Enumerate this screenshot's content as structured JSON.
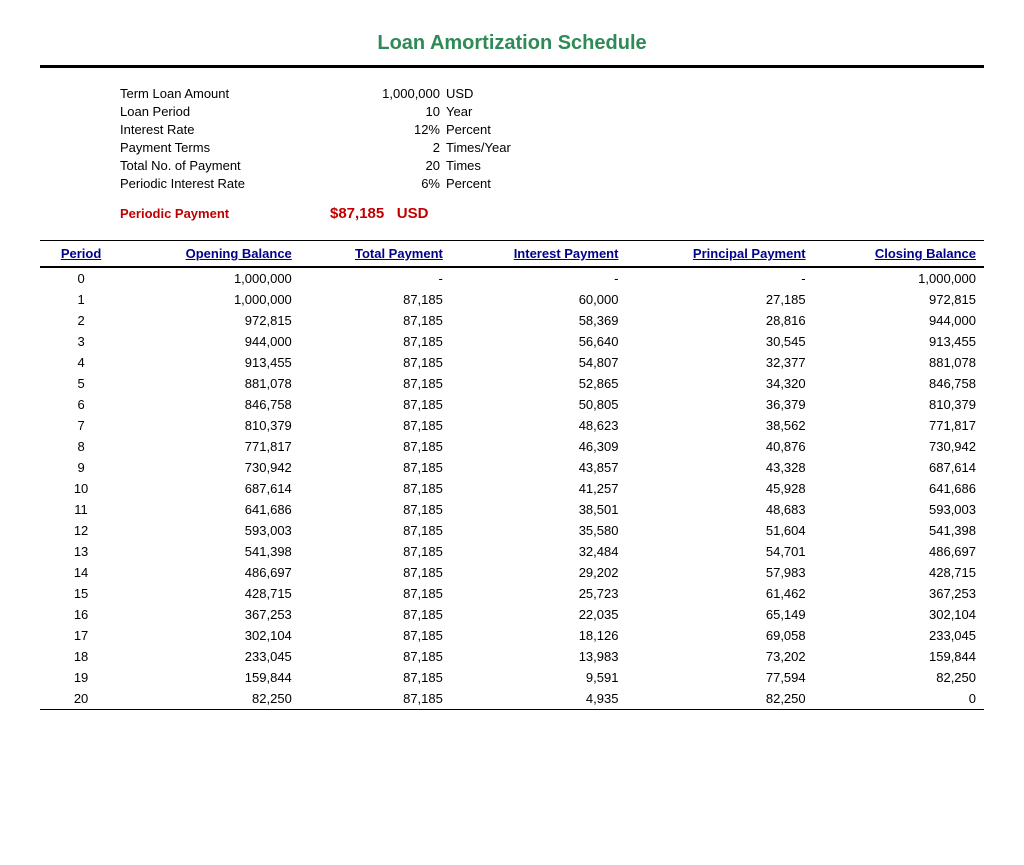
{
  "title": "Loan Amortization Schedule",
  "info": {
    "rows": [
      {
        "label": "Term Loan Amount",
        "value": "1,000,000",
        "unit": "USD"
      },
      {
        "label": "Loan Period",
        "value": "10",
        "unit": "Year"
      },
      {
        "label": "Interest Rate",
        "value": "12%",
        "unit": "Percent"
      },
      {
        "label": "Payment Terms",
        "value": "2",
        "unit": "Times/Year"
      },
      {
        "label": "Total No. of Payment",
        "value": "20",
        "unit": "Times"
      },
      {
        "label": "Periodic Interest Rate",
        "value": "6%",
        "unit": "Percent"
      }
    ]
  },
  "periodic": {
    "label": "Periodic Payment",
    "value": "$87,185",
    "unit": "USD"
  },
  "table": {
    "headers": [
      "Period",
      "Opening Balance",
      "Total Payment",
      "Interest Payment",
      "Principal Payment",
      "Closing Balance"
    ],
    "rows": [
      [
        0,
        "1,000,000",
        "-",
        "-",
        "-",
        "1,000,000"
      ],
      [
        1,
        "1,000,000",
        "87,185",
        "60,000",
        "27,185",
        "972,815"
      ],
      [
        2,
        "972,815",
        "87,185",
        "58,369",
        "28,816",
        "944,000"
      ],
      [
        3,
        "944,000",
        "87,185",
        "56,640",
        "30,545",
        "913,455"
      ],
      [
        4,
        "913,455",
        "87,185",
        "54,807",
        "32,377",
        "881,078"
      ],
      [
        5,
        "881,078",
        "87,185",
        "52,865",
        "34,320",
        "846,758"
      ],
      [
        6,
        "846,758",
        "87,185",
        "50,805",
        "36,379",
        "810,379"
      ],
      [
        7,
        "810,379",
        "87,185",
        "48,623",
        "38,562",
        "771,817"
      ],
      [
        8,
        "771,817",
        "87,185",
        "46,309",
        "40,876",
        "730,942"
      ],
      [
        9,
        "730,942",
        "87,185",
        "43,857",
        "43,328",
        "687,614"
      ],
      [
        10,
        "687,614",
        "87,185",
        "41,257",
        "45,928",
        "641,686"
      ],
      [
        11,
        "641,686",
        "87,185",
        "38,501",
        "48,683",
        "593,003"
      ],
      [
        12,
        "593,003",
        "87,185",
        "35,580",
        "51,604",
        "541,398"
      ],
      [
        13,
        "541,398",
        "87,185",
        "32,484",
        "54,701",
        "486,697"
      ],
      [
        14,
        "486,697",
        "87,185",
        "29,202",
        "57,983",
        "428,715"
      ],
      [
        15,
        "428,715",
        "87,185",
        "25,723",
        "61,462",
        "367,253"
      ],
      [
        16,
        "367,253",
        "87,185",
        "22,035",
        "65,149",
        "302,104"
      ],
      [
        17,
        "302,104",
        "87,185",
        "18,126",
        "69,058",
        "233,045"
      ],
      [
        18,
        "233,045",
        "87,185",
        "13,983",
        "73,202",
        "159,844"
      ],
      [
        19,
        "159,844",
        "87,185",
        "9,591",
        "77,594",
        "82,250"
      ],
      [
        20,
        "82,250",
        "87,185",
        "4,935",
        "82,250",
        "0"
      ]
    ]
  }
}
